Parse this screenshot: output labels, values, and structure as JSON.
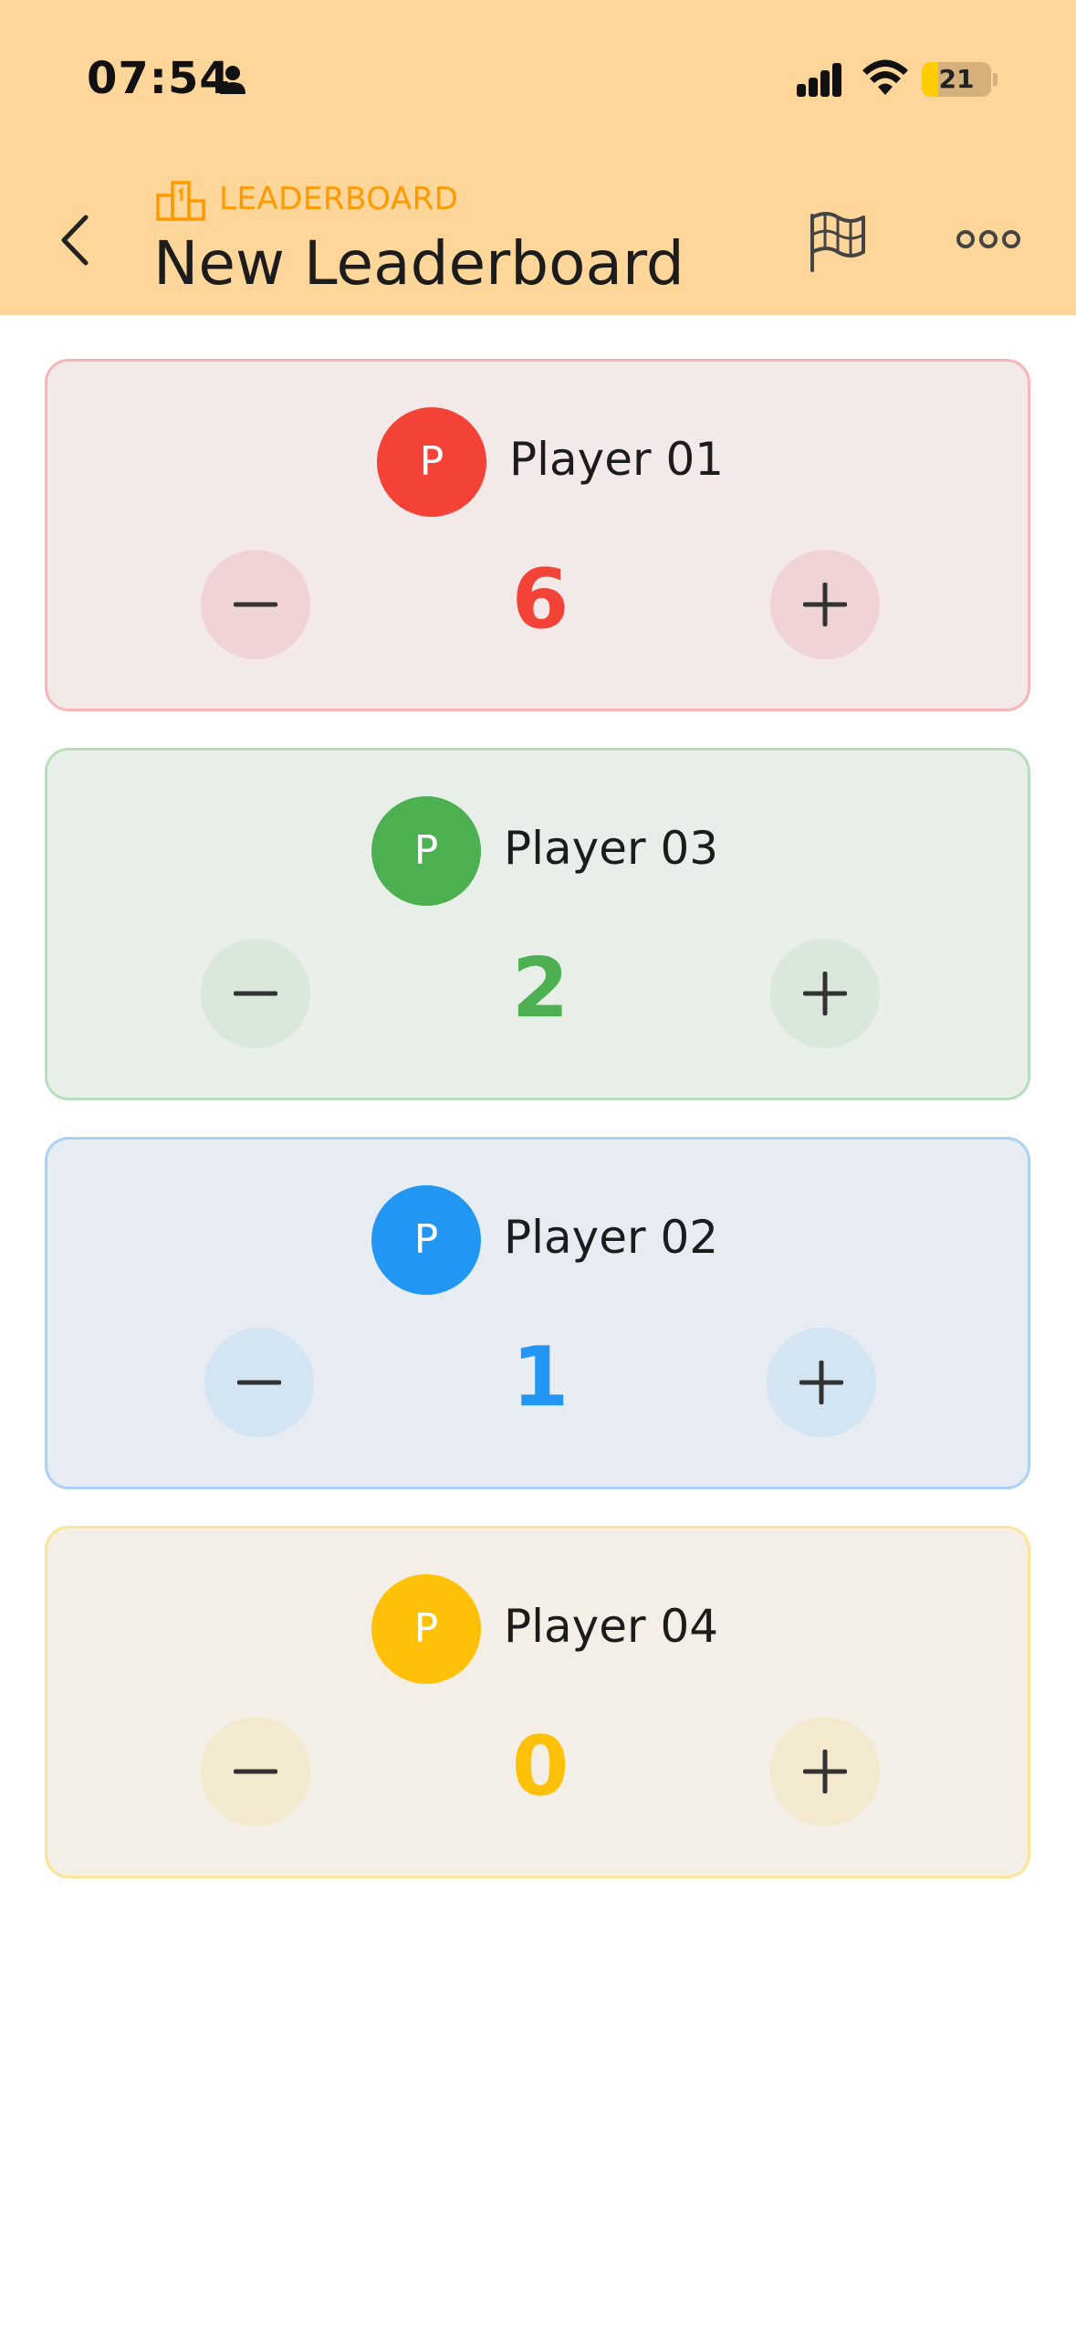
{
  "status_bar": {
    "time": "07:54",
    "battery": "21"
  },
  "header": {
    "subtitle": "LEADERBOARD",
    "title": "New Leaderboard"
  },
  "players": [
    {
      "name": "Player 01",
      "initial": "P",
      "score": "6",
      "color": "#F44336"
    },
    {
      "name": "Player 03",
      "initial": "P",
      "score": "2",
      "color": "#4CAF50"
    },
    {
      "name": "Player 02",
      "initial": "P",
      "score": "1",
      "color": "#2196F3"
    },
    {
      "name": "Player 04",
      "initial": "P",
      "score": "0",
      "color": "#FFC107"
    }
  ],
  "icons": {
    "back": "chevron-left-icon",
    "leaderboard": "podium-icon",
    "flag": "flag-icon",
    "more": "more-horizontal-icon",
    "minus": "minus-icon",
    "plus": "plus-icon"
  }
}
